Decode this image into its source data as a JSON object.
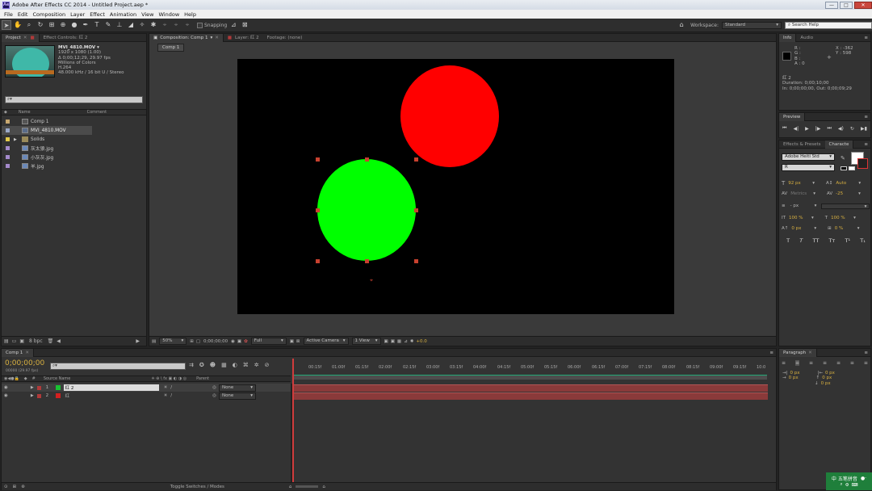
{
  "window": {
    "title": "Adobe After Effects CC 2014 - Untitled Project.aep *",
    "app_icon": "Ae",
    "controls": [
      "minimize-icon",
      "maximize-icon",
      "close-icon"
    ]
  },
  "menu": [
    "File",
    "Edit",
    "Composition",
    "Layer",
    "Effect",
    "Animation",
    "View",
    "Window",
    "Help"
  ],
  "toolbar": {
    "snapping": "Snapping",
    "workspace_label": "Workspace:",
    "workspace_value": "Standard",
    "search_help": "Search Help"
  },
  "project": {
    "tabs": [
      "Project",
      "Effect Controls: 红 2"
    ],
    "file": {
      "name": "MVI_4810.MOV ▾",
      "dims": "1920 x 1080 (1.00)",
      "duration": "Δ 0;00;12;29, 29.97 fps",
      "colors": "Millions of Colors",
      "codec": "H.264",
      "audio": "48.000 kHz / 16 bit U / Stereo"
    },
    "search_placeholder": "⌕▾",
    "columns": {
      "name": "Name",
      "comment": "Comment"
    },
    "items": [
      {
        "name": "Comp 1",
        "label_color": "#c8a870",
        "icon": "composition-icon"
      },
      {
        "name": "MVI_4810.MOV",
        "label_color": "#9aa8c8",
        "icon": "footage-icon"
      },
      {
        "name": "Solids",
        "label_color": "#e2c94a",
        "icon": "folder-icon"
      },
      {
        "name": "灰太狼.jpg",
        "label_color": "#a48acb",
        "icon": "image-file-icon"
      },
      {
        "name": "小灰灰.jpg",
        "label_color": "#a48acb",
        "icon": "image-file-icon"
      },
      {
        "name": "羊.jpg",
        "label_color": "#a48acb",
        "icon": "image-file-icon"
      }
    ],
    "bpc": "8 bpc"
  },
  "composition": {
    "tabs": [
      "Composition: Comp 1",
      "Layer: 红 2",
      "Footage: (none)"
    ],
    "breadcrumb": "Comp 1",
    "zoom": "50%",
    "timecode": "0;00;00;00",
    "resolution": "Full",
    "camera": "Active Camera",
    "views": "1 View",
    "exposure": "+0.0",
    "colors": {
      "red": "#ff0000",
      "green": "#00ff00",
      "bg": "#000000"
    }
  },
  "info": {
    "tabs": [
      "Info",
      "Audio"
    ],
    "r": "R :",
    "g": "G :",
    "b": "B :",
    "a": "A : 0",
    "x": "X : -362",
    "y": "Y : 598",
    "layer": "红 2",
    "duration": "Duration: 0;00;10;00",
    "inout": "In: 0;00;00;00, Out: 0;00;09;29"
  },
  "preview": {
    "tab": "Preview"
  },
  "character": {
    "tabs": [
      "Effects & Presets",
      "Characte"
    ],
    "font": "Adobe Heiti Std",
    "style": "R",
    "size": "92 px",
    "leading": "Auto",
    "kerning": "Metrics",
    "tracking": "-25",
    "stroke": "- px",
    "vscale": "100 %",
    "hscale": "100 %",
    "baseline": "0 px",
    "tsume": "0 %",
    "styles": [
      "T",
      "T",
      "TT",
      "Tт",
      "T¹",
      "T₁"
    ]
  },
  "paragraph": {
    "tab": "Paragraph",
    "values": [
      "0 px",
      "0 px",
      "0 px",
      "0 px",
      "0 px"
    ]
  },
  "timeline": {
    "tab": "Comp 1",
    "timecode": "0;00;00;00",
    "sub": "00000 (29.97 fps)",
    "search_placeholder": "⌕▾",
    "cols": {
      "num": "#",
      "source": "Source Name",
      "parent": "Parent"
    },
    "layers": [
      {
        "num": "1",
        "name": "红 2",
        "color": "#19c232",
        "parent": "None"
      },
      {
        "num": "2",
        "name": "红",
        "color": "#d32020",
        "parent": "None"
      }
    ],
    "ruler": [
      "00:15f",
      "01:00f",
      "01:15f",
      "02:00f",
      "02:15f",
      "03:00f",
      "03:15f",
      "04:00f",
      "04:15f",
      "05:00f",
      "05:15f",
      "06:00f",
      "06:15f",
      "07:00f",
      "07:15f",
      "08:00f",
      "08:15f",
      "09:00f",
      "09:15f",
      "10:0"
    ],
    "toggle": "Toggle Switches / Modes"
  },
  "ime": {
    "label": "五笔拼音"
  }
}
